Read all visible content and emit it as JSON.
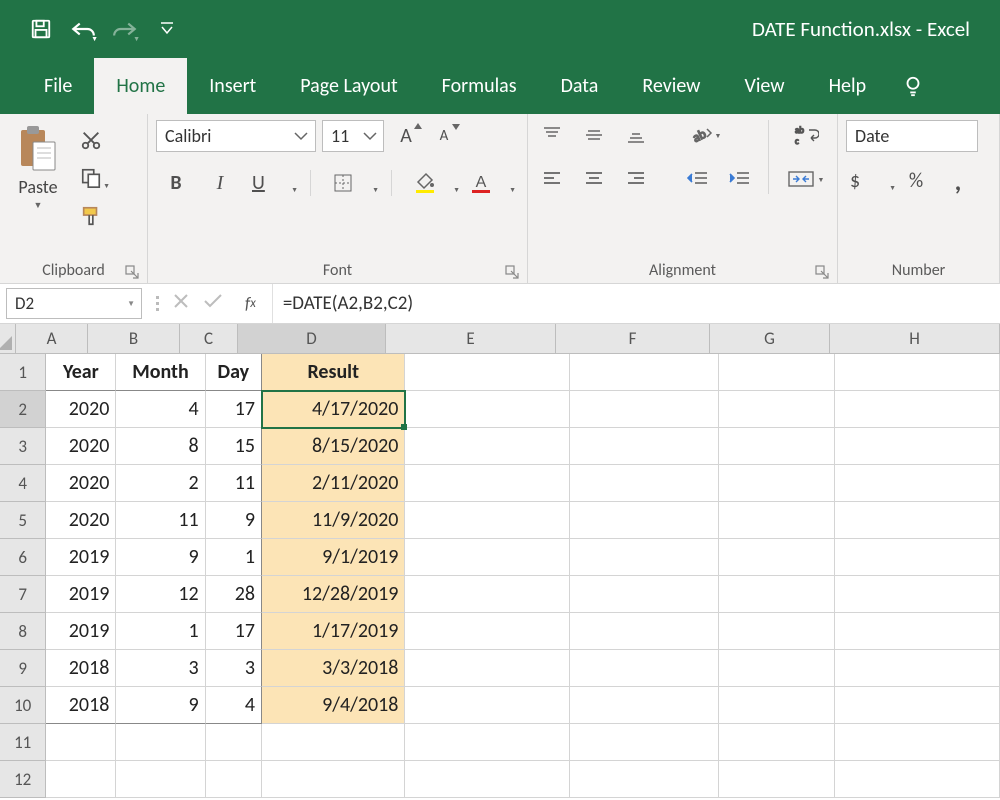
{
  "title": {
    "filename": "DATE Function.xlsx",
    "sep": " - ",
    "app": "Excel"
  },
  "tabs": {
    "file": "File",
    "home": "Home",
    "insert": "Insert",
    "page_layout": "Page Layout",
    "formulas": "Formulas",
    "data": "Data",
    "review": "Review",
    "view": "View",
    "help": "Help"
  },
  "ribbon": {
    "clipboard": {
      "paste": "Paste",
      "label": "Clipboard"
    },
    "font": {
      "name": "Calibri",
      "size": "11",
      "label": "Font",
      "bold": "B",
      "italic": "I",
      "underline": "U"
    },
    "alignment": {
      "label": "Alignment"
    },
    "number": {
      "format": "Date",
      "label": "Number",
      "currency": "$",
      "percent": "%",
      "comma": ","
    }
  },
  "formula_bar": {
    "name_box": "D2",
    "fx": "fx",
    "formula": "=DATE(A2,B2,C2)"
  },
  "columns": [
    "A",
    "B",
    "C",
    "D",
    "E",
    "F",
    "G",
    "H"
  ],
  "headers": {
    "A": "Year",
    "B": "Month",
    "C": "Day",
    "D": "Result"
  },
  "rows": [
    {
      "n": "1"
    },
    {
      "n": "2",
      "A": "2020",
      "B": "4",
      "C": "17",
      "D": "4/17/2020"
    },
    {
      "n": "3",
      "A": "2020",
      "B": "8",
      "C": "15",
      "D": "8/15/2020"
    },
    {
      "n": "4",
      "A": "2020",
      "B": "2",
      "C": "11",
      "D": "2/11/2020"
    },
    {
      "n": "5",
      "A": "2020",
      "B": "11",
      "C": "9",
      "D": "11/9/2020"
    },
    {
      "n": "6",
      "A": "2019",
      "B": "9",
      "C": "1",
      "D": "9/1/2019"
    },
    {
      "n": "7",
      "A": "2019",
      "B": "12",
      "C": "28",
      "D": "12/28/2019"
    },
    {
      "n": "8",
      "A": "2019",
      "B": "1",
      "C": "17",
      "D": "1/17/2019"
    },
    {
      "n": "9",
      "A": "2018",
      "B": "3",
      "C": "3",
      "D": "3/3/2018"
    },
    {
      "n": "10",
      "A": "2018",
      "B": "9",
      "C": "4",
      "D": "9/4/2018"
    },
    {
      "n": "11"
    },
    {
      "n": "12"
    }
  ]
}
